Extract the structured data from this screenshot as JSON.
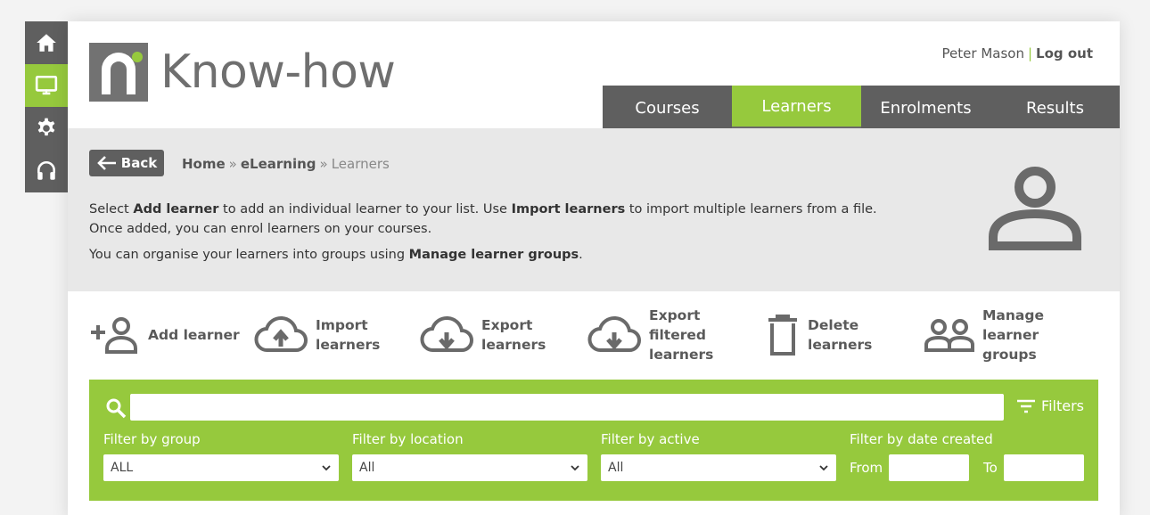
{
  "rail": {
    "items": [
      {
        "icon": "home-icon",
        "active": false
      },
      {
        "icon": "monitor-icon",
        "active": true
      },
      {
        "icon": "gear-icon",
        "active": false
      },
      {
        "icon": "headset-icon",
        "active": false
      }
    ]
  },
  "brand": {
    "name": "Know-how"
  },
  "user": {
    "name": "Peter Mason",
    "separator": "|",
    "logout_label": "Log out"
  },
  "nav": {
    "tabs": [
      {
        "label": "Courses",
        "active": false
      },
      {
        "label": "Learners",
        "active": true
      },
      {
        "label": "Enrolments",
        "active": false
      },
      {
        "label": "Results",
        "active": false
      }
    ]
  },
  "intro": {
    "back_label": "Back",
    "breadcrumb": {
      "home": "Home",
      "sep": "»",
      "elearning": "eLearning",
      "current": "Learners"
    },
    "line1_a": "Select ",
    "line1_b": "Add learner",
    "line1_c": " to add an individual learner to your list. Use ",
    "line1_d": "Import learners",
    "line1_e": " to import multiple learners from a file.",
    "line2": "Once added, you can enrol learners on your courses.",
    "line3_a": "You can organise your learners into groups using ",
    "line3_b": "Manage learner groups",
    "line3_c": "."
  },
  "actions": {
    "add": {
      "line1": "Add learner"
    },
    "import": {
      "line1": "Import",
      "line2": "learners"
    },
    "export": {
      "line1": "Export",
      "line2": "learners"
    },
    "export_filtered": {
      "line1": "Export",
      "line2": "filtered",
      "line3": "learners"
    },
    "delete": {
      "line1": "Delete",
      "line2": "learners"
    },
    "groups": {
      "line1": "Manage",
      "line2": "learner",
      "line3": "groups"
    }
  },
  "filters": {
    "search_value": "",
    "filters_label": "Filters",
    "group": {
      "label": "Filter by group",
      "value": "ALL"
    },
    "location": {
      "label": "Filter by location",
      "value": "All"
    },
    "active": {
      "label": "Filter by active",
      "value": "All"
    },
    "date": {
      "label": "Filter by date created",
      "from_label": "From",
      "to_label": "To",
      "from_value": "",
      "to_value": ""
    }
  },
  "colors": {
    "accent": "#96c93d",
    "dark": "#5f5f5f",
    "panel": "#e8e8e8"
  }
}
